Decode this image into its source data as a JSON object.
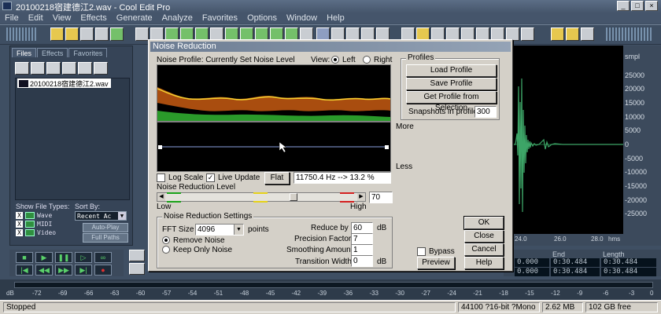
{
  "window": {
    "title": "20100218宿建德江2.wav - Cool Edit Pro"
  },
  "menu": [
    "File",
    "Edit",
    "View",
    "Effects",
    "Generate",
    "Analyze",
    "Favorites",
    "Options",
    "Window",
    "Help"
  ],
  "leftpanel": {
    "tabs": [
      "Files",
      "Effects",
      "Favorites"
    ],
    "file_entry": "20100218宿建德江2.wav",
    "show_file_types_label": "Show File Types:",
    "sort_by_label": "Sort By:",
    "types": [
      {
        "label": "Wave",
        "checked": "X"
      },
      {
        "label": "MIDI",
        "checked": "X"
      },
      {
        "label": "Video",
        "checked": "X"
      }
    ],
    "sort_value": "Recent Ac",
    "autoplay_label": "Auto-Play",
    "fullpaths_label": "Full Paths"
  },
  "waveview": {
    "ruler_unit": "smpl",
    "amplitude_ticks": [
      "25000",
      "20000",
      "15000",
      "10000",
      "5000",
      "0",
      "-5000",
      "-10000",
      "-15000",
      "-20000",
      "-25000"
    ],
    "time_ticks": [
      "24.0",
      "26.0",
      "28.0"
    ],
    "time_unit": "hms"
  },
  "timepanel": {
    "headers": [
      "End",
      "Length"
    ],
    "row1": [
      "0.000",
      "0:30.484",
      "0:30.484"
    ],
    "row2": [
      "0.000",
      "0:30.484",
      "0:30.484"
    ]
  },
  "levels": [
    "dB",
    "-72",
    "-69",
    "-66",
    "-63",
    "-60",
    "-57",
    "-54",
    "-51",
    "-48",
    "-45",
    "-42",
    "-39",
    "-36",
    "-33",
    "-30",
    "-27",
    "-24",
    "-21",
    "-18",
    "-15",
    "-12",
    "-9",
    "-6",
    "-3",
    "0"
  ],
  "status": {
    "state": "Stopped",
    "format": "44100 ?16-bit ?Mono",
    "size": "2.62 MB",
    "free": "102 GB free"
  },
  "dialog": {
    "title": "Noise Reduction",
    "profile_label": "Noise Profile: Currently Set Noise Level",
    "view_label": "View:",
    "view_left": "Left",
    "view_right": "Right",
    "more_label": "More",
    "less_label": "Less",
    "log_scale_label": "Log Scale",
    "log_scale_checked": "",
    "live_update_label": "Live Update",
    "live_update_checked": "✓",
    "flat_label": "Flat",
    "freq_readout": "11750.4 Hz --> 13.2 %",
    "nr_level_label": "Noise Reduction Level",
    "nr_level_value": "70",
    "low_label": "Low",
    "high_label": "High",
    "profiles": {
      "legend": "Profiles",
      "load": "Load Profile",
      "save": "Save Profile",
      "get": "Get Profile from Selection",
      "snapshots_label": "Snapshots in profile",
      "snapshots_value": "300"
    },
    "settings": {
      "legend": "Noise Reduction Settings",
      "fft_label": "FFT Size",
      "fft_value": "4096",
      "points_label": "points",
      "remove_label": "Remove Noise",
      "keep_label": "Keep Only Noise",
      "reduce_label": "Reduce by",
      "reduce_value": "60",
      "reduce_unit": "dB",
      "precision_label": "Precision Factor",
      "precision_value": "7",
      "smoothing_label": "Smoothing Amount",
      "smoothing_value": "1",
      "transition_label": "Transition Width",
      "transition_value": "0",
      "transition_unit": "dB"
    },
    "buttons": {
      "ok": "OK",
      "close": "Close",
      "cancel": "Cancel",
      "help": "Help",
      "preview": "Preview",
      "bypass": "Bypass"
    }
  }
}
